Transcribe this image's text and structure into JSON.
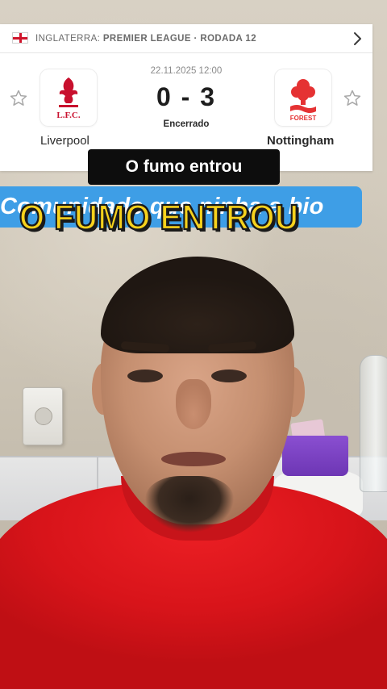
{
  "match": {
    "country": "INGLATERRA:",
    "league": "PREMIER LEAGUE · RODADA 12",
    "datetime": "22.11.2025 12:00",
    "score": "0 - 3",
    "status": "Encerrado",
    "home": {
      "name": "Liverpool",
      "crest_text": "L.F.C.",
      "crest_icon": "liverpool-crest-icon",
      "crest_color": "#c8102e"
    },
    "away": {
      "name": "Nottingham",
      "crest_text": "FOREST",
      "crest_icon": "nottingham-forest-crest-icon",
      "crest_color": "#e53233"
    }
  },
  "captions": {
    "top": "O fumo entrou",
    "banner": "Comunidade que ninha a bio",
    "main": "O FUMO ENTROU"
  },
  "icons": {
    "flag": "england-flag-icon",
    "chevron": "chevron-right-icon",
    "favorite": "star-outline-icon"
  },
  "colors": {
    "banner": "#3e9ee6",
    "caption_yellow": "#f7d21c",
    "shirt": "#d8141a"
  }
}
